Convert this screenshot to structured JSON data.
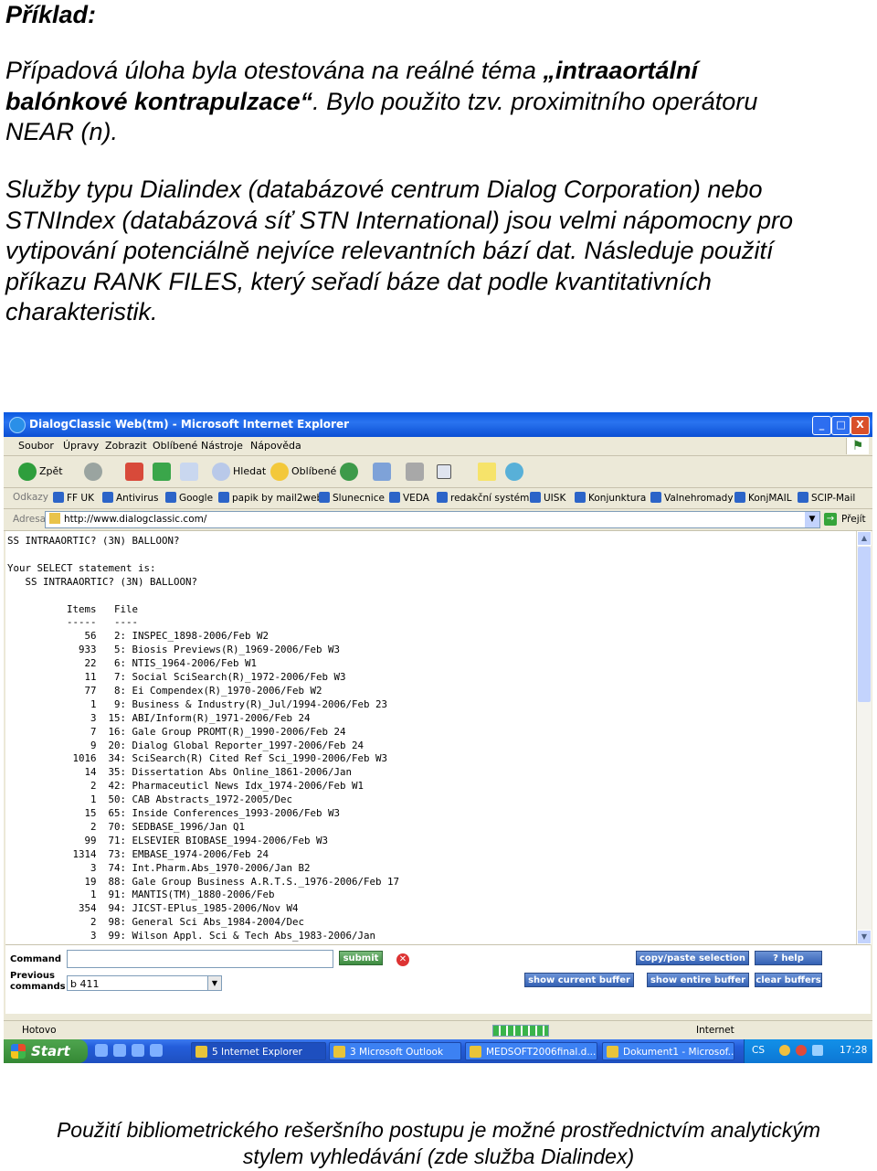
{
  "heading": "Příklad:",
  "paragraph1": {
    "lines": [
      [
        "Případová úloha byla otestována na reálné téma ",
        {
          "b": "„intraaortální"
        }
      ],
      [
        {
          "b": "balónkové kontrapulzace“"
        },
        ". Bylo použito tzv. proximitního operátoru"
      ],
      [
        "NEAR (n)."
      ]
    ]
  },
  "paragraph2": {
    "lines": [
      "Služby typu Dialindex (databázové centrum Dialog Corporation) nebo",
      "STNIndex (databázová síť STN International) jsou velmi nápomocny pro",
      "vytipování potenciálně nejvíce relevantních bází dat. Následuje použití",
      "příkazu RANK FILES, který seřadí báze dat podle kvantitativních",
      "charakteristik."
    ]
  },
  "caption": {
    "lines": [
      "Použití bibliometrického rešeršního postupu je možné prostřednictvím  analytickým",
      "stylem vyhledávání (zde služba Dialindex)"
    ]
  },
  "browser": {
    "window_title": "DialogClassic Web(tm) - Microsoft Internet Explorer",
    "window_controls": [
      "_",
      "□",
      "X"
    ],
    "menu": [
      "Soubor",
      "Úpravy",
      "Zobrazit",
      "Oblíbené",
      "Nástroje",
      "Nápověda"
    ],
    "toolbar": {
      "back": "Zpět",
      "search": "Hledat",
      "favorites": "Oblíbené"
    },
    "links_label": "Odkazy",
    "links": [
      "FF UK",
      "Antivirus",
      "Google",
      "papik by mail2web",
      "Slunecnice",
      "VEDA",
      "redakční systém",
      "UISK",
      "Konjunktura",
      "Valnehromady",
      "KonjMAIL",
      "SCIP-Mail"
    ],
    "address_label": "Adresa",
    "address": "http://www.dialogclassic.com/",
    "go_label": "Přejít",
    "status_left": "Hotovo",
    "status_zone": "Internet"
  },
  "terminal": {
    "lines": [
      "SS INTRAAORTIC? (3N) BALLOON?",
      "",
      "Your SELECT statement is:",
      "   SS INTRAAORTIC? (3N) BALLOON?",
      "",
      "          Items   File",
      "          -----   ----",
      "             56   2: INSPEC_1898-2006/Feb W2",
      "            933   5: Biosis Previews(R)_1969-2006/Feb W3",
      "             22   6: NTIS_1964-2006/Feb W1",
      "             11   7: Social SciSearch(R)_1972-2006/Feb W3",
      "             77   8: Ei Compendex(R)_1970-2006/Feb W2",
      "              1   9: Business & Industry(R)_Jul/1994-2006/Feb 23",
      "              3  15: ABI/Inform(R)_1971-2006/Feb 24",
      "              7  16: Gale Group PROMT(R)_1990-2006/Feb 24",
      "              9  20: Dialog Global Reporter_1997-2006/Feb 24",
      "           1016  34: SciSearch(R) Cited Ref Sci_1990-2006/Feb W3",
      "             14  35: Dissertation Abs Online_1861-2006/Jan",
      "              2  42: Pharmaceuticl News Idx_1974-2006/Feb W1",
      "              1  50: CAB Abstracts_1972-2005/Dec",
      "             15  65: Inside Conferences_1993-2006/Feb W3",
      "              2  70: SEDBASE_1996/Jan Q1",
      "             99  71: ELSEVIER BIOBASE_1994-2006/Feb W3",
      "           1314  73: EMBASE_1974-2006/Feb 24",
      "              3  74: Int.Pharm.Abs_1970-2006/Jan B2",
      "             19  88: Gale Group Business A.R.T.S._1976-2006/Feb 17",
      "              1  91: MANTIS(TM)_1880-2006/Feb",
      "            354  94: JICST-EPlus_1985-2006/Nov W4",
      "              2  98: General Sci Abs_1984-2004/Dec",
      "              3  99: Wilson Appl. Sci & Tech Abs_1983-2006/Jan"
    ]
  },
  "command_panel": {
    "command_label": "Command",
    "previous_label_1": "Previous",
    "previous_label_2": "commands",
    "previous_value": "b 411",
    "submit": "submit",
    "copy_paste": "copy/paste selection",
    "help": "? help",
    "show_current": "show current buffer",
    "show_entire": "show entire buffer",
    "clear": "clear buffers"
  },
  "taskbar": {
    "start": "Start",
    "tasks": [
      "5 Internet Explorer",
      "3 Microsoft Outlook",
      "MEDSOFT2006final.d...",
      "Dokument1 - Microsof..."
    ],
    "lang": "CS",
    "clock": "17:28"
  },
  "colors": {
    "titlebar": "#0a58e0",
    "taskbar": "#245edb",
    "start": "#348834",
    "accent_button": "#3461b4"
  }
}
